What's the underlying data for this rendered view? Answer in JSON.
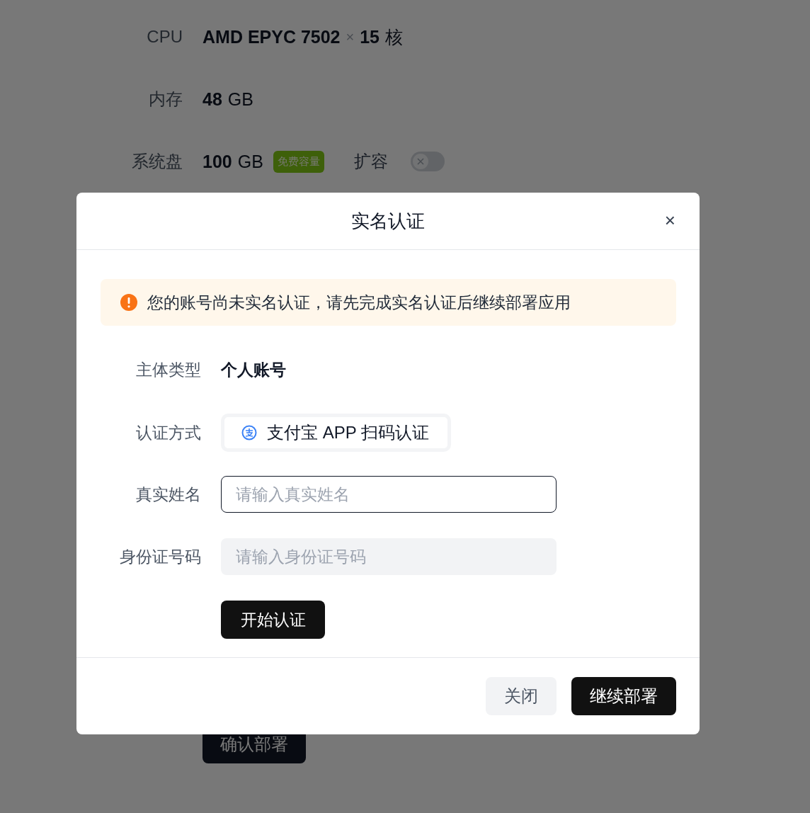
{
  "specs": [
    {
      "label": "CPU",
      "value": "AMD EPYC 7502",
      "multiplier": "×",
      "count": "15",
      "unit": "核"
    },
    {
      "label": "内存",
      "value": "48",
      "unit": "GB"
    },
    {
      "label": "系统盘",
      "value": "100",
      "unit": "GB",
      "tag": "免费容量",
      "toggle": {
        "label": "扩容",
        "on": false
      }
    }
  ],
  "confirm_button": "确认部署",
  "dialog": {
    "title": "实名认证",
    "close": "×",
    "alert": {
      "kind": "warning",
      "text": "您的账号尚未实名认证，请先完成实名认证后继续部署应用"
    },
    "fields": [
      {
        "kind": "text",
        "label": "主体类型",
        "value": "个人账号"
      },
      {
        "kind": "option",
        "label": "认证方式",
        "value": "支付宝 APP 扫码认证",
        "selected": true
      },
      {
        "kind": "input",
        "label": "真实姓名",
        "placeholder": "请输入真实姓名",
        "focused": true
      },
      {
        "kind": "input",
        "label": "身份证号码",
        "placeholder": "请输入身份证号码",
        "focused": false
      }
    ],
    "start_button": "开始认证",
    "buttons": [
      {
        "label": "关闭",
        "primary": false
      },
      {
        "label": "继续部署",
        "primary": true
      }
    ]
  }
}
